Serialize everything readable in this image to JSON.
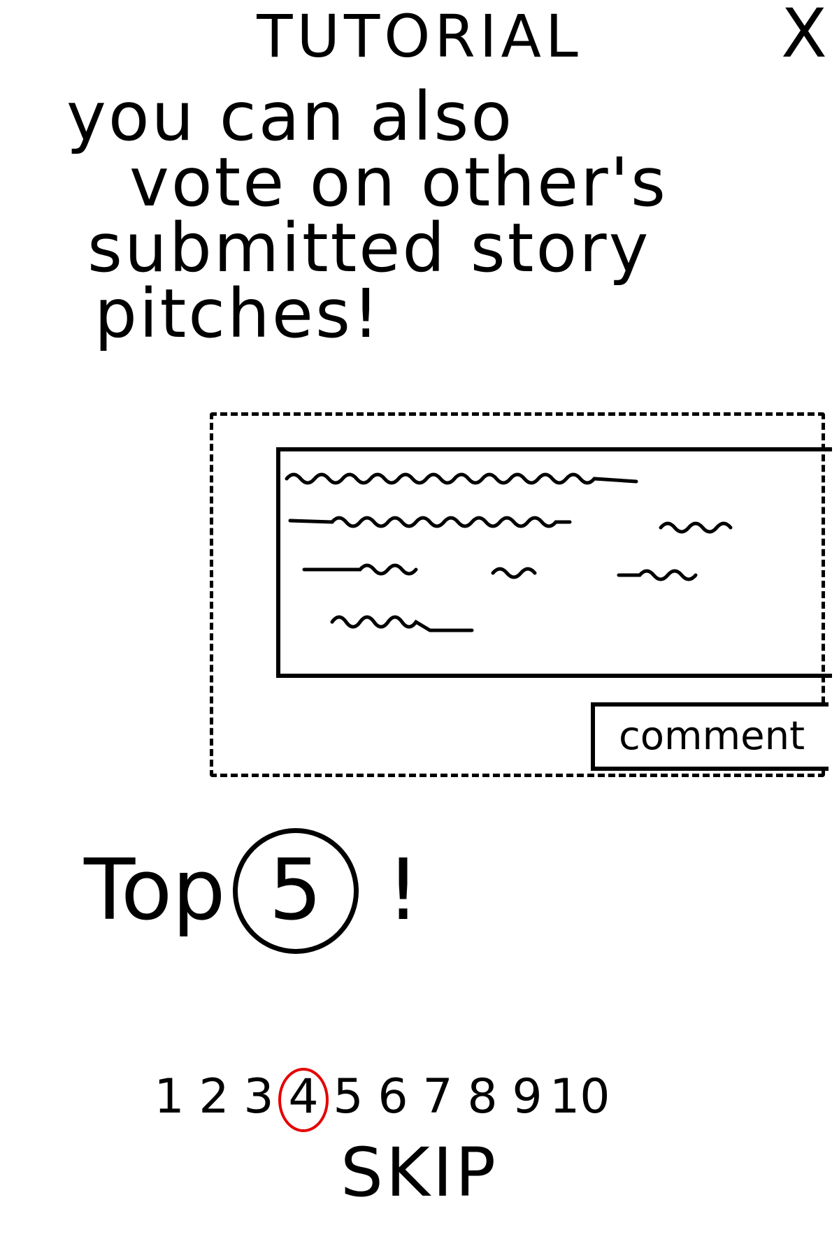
{
  "header": {
    "title": "TUTORIAL",
    "close_label": "X"
  },
  "headline": {
    "line1": "you can also",
    "line2": "vote on other's",
    "line3": "submitted story",
    "line4": "pitches!"
  },
  "mock_card": {
    "comment_label": "comment"
  },
  "top": {
    "label": "Top",
    "count": "5",
    "exclaim": "!"
  },
  "pager": {
    "pages": [
      "1",
      "2",
      "3",
      "4",
      "5",
      "6",
      "7",
      "8",
      "9",
      "10"
    ],
    "current": "4",
    "current_marker_color": "#e60000"
  },
  "footer": {
    "skip_label": "SKIP"
  }
}
